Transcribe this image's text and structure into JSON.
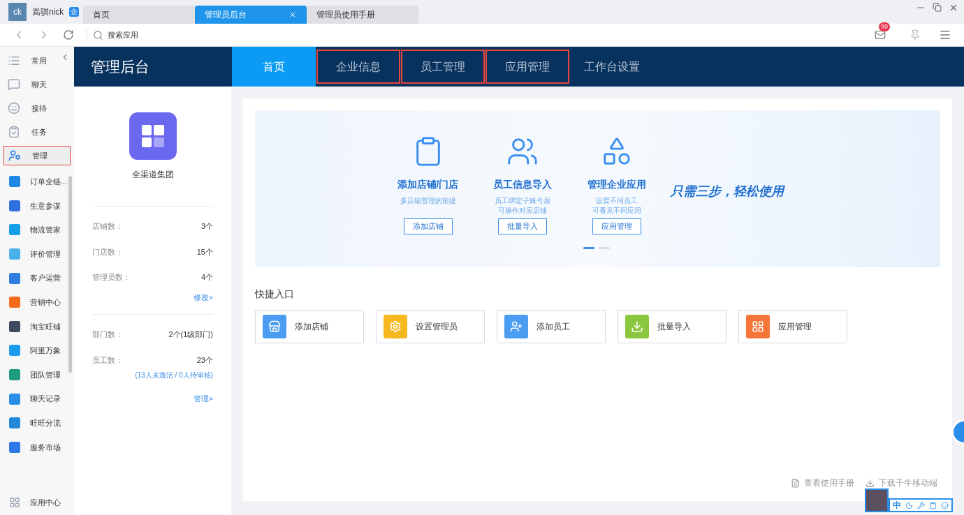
{
  "window": {
    "user_badge": "ck",
    "user_name": "嵩骐nick",
    "enterprise_mark": "企"
  },
  "tabs": [
    {
      "label": "首页",
      "selected": false,
      "closable": false
    },
    {
      "label": "管理员后台",
      "selected": true,
      "closable": true
    },
    {
      "label": "管理员使用手册",
      "selected": false,
      "closable": false
    }
  ],
  "toolbar": {
    "search_placeholder": "搜索应用",
    "mail_badge": "99"
  },
  "sidebar": {
    "fixed": [
      {
        "label": "常用",
        "kind": "list",
        "selected": false
      },
      {
        "label": "聊天",
        "kind": "chat",
        "selected": false
      },
      {
        "label": "接待",
        "kind": "reception",
        "selected": false
      },
      {
        "label": "任务",
        "kind": "task",
        "selected": false
      },
      {
        "label": "管理",
        "kind": "admin",
        "selected": true
      }
    ],
    "apps": [
      {
        "label": "订单全链...",
        "color": "#1e88e5"
      },
      {
        "label": "生意参谋",
        "color": "#2f6fe0"
      },
      {
        "label": "物流管家",
        "color": "#14a0e8"
      },
      {
        "label": "评价管理",
        "color": "#4ab0ea"
      },
      {
        "label": "客户运营",
        "color": "#2d7ee0"
      },
      {
        "label": "营销中心",
        "color": "#f36a1c"
      },
      {
        "label": "淘宝旺铺",
        "color": "#3d4a60"
      },
      {
        "label": "阿里万象",
        "color": "#1d9bef"
      },
      {
        "label": "团队管理",
        "color": "#1e9b7e"
      },
      {
        "label": "聊天记录",
        "color": "#2a8ee8"
      },
      {
        "label": "旺旺分流",
        "color": "#2388d8"
      },
      {
        "label": "服务市场",
        "color": "#2f78e8"
      }
    ],
    "footer": "应用中心"
  },
  "header": {
    "title": "管理后台",
    "nav": [
      {
        "label": "首页",
        "selected": true,
        "highlighted": false
      },
      {
        "label": "企业信息",
        "selected": false,
        "highlighted": true
      },
      {
        "label": "员工管理",
        "selected": false,
        "highlighted": true
      },
      {
        "label": "应用管理",
        "selected": false,
        "highlighted": true
      },
      {
        "label": "工作台设置",
        "selected": false,
        "highlighted": false
      }
    ]
  },
  "company": {
    "name": "全渠道集团",
    "stats": [
      {
        "label": "店铺数：",
        "value": "3个"
      },
      {
        "label": "门店数：",
        "value": "15个"
      },
      {
        "label": "管理员数：",
        "value": "4个"
      }
    ],
    "edit_link": "修改>",
    "org_stats": [
      {
        "label": "部门数：",
        "value": "2个(1级部门)"
      },
      {
        "label": "员工数：",
        "value": "23个"
      }
    ],
    "employee_note": "(13人未激活 / 0人待审核)",
    "manage_link": "管理>"
  },
  "banner": {
    "steps": [
      {
        "kind": "clipboard",
        "title": "添加店铺/门店",
        "desc": [
          "多店铺管理的前提"
        ],
        "button": "添加店铺"
      },
      {
        "kind": "people",
        "title": "员工信息导入",
        "desc": [
          "员工绑定子账号后",
          "可操作对应店铺"
        ],
        "button": "批量导入"
      },
      {
        "kind": "apps",
        "title": "管理企业应用",
        "desc": [
          "设置不同员工",
          "可看见不同应用"
        ],
        "button": "应用管理"
      }
    ],
    "slogan": "只需三步，轻松使用",
    "dots": [
      {
        "selected": true
      },
      {
        "selected": false
      }
    ]
  },
  "shortcuts": {
    "title": "快捷入口",
    "items": [
      {
        "label": "添加店铺",
        "kind": "store",
        "color": "#4a9df0"
      },
      {
        "label": "设置管理员",
        "kind": "gear",
        "color": "#f6b81f"
      },
      {
        "label": "添加员工",
        "kind": "user",
        "color": "#4a9df0"
      },
      {
        "label": "批量导入",
        "kind": "download",
        "color": "#8bc63f"
      },
      {
        "label": "应用管理",
        "kind": "grid",
        "color": "#f6763a"
      }
    ]
  },
  "footer_links": [
    {
      "label": "查看使用手册",
      "kind": "doc"
    },
    {
      "label": "下载千牛移动端",
      "kind": "download"
    }
  ],
  "ime": {
    "mode": "中"
  }
}
